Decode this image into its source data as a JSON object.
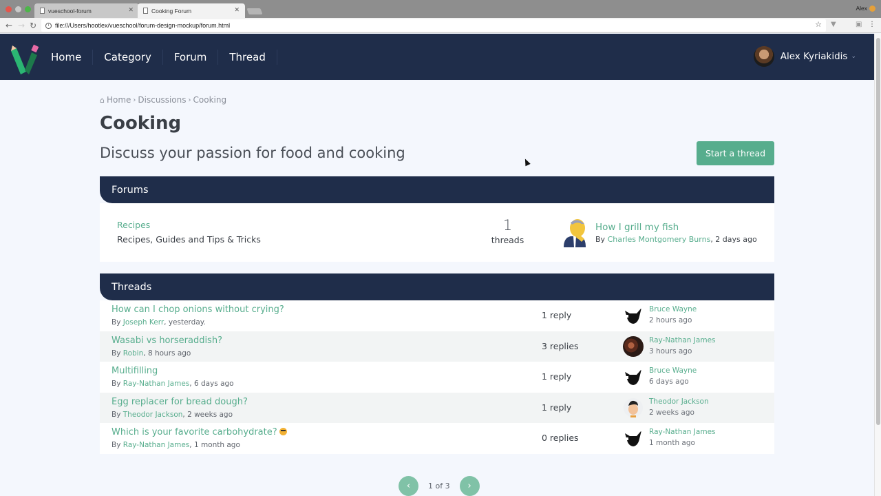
{
  "browser": {
    "tabs": [
      {
        "title": "vueschool-forum",
        "active": false
      },
      {
        "title": "Cooking Forum",
        "active": true
      }
    ],
    "profile_name": "Alex",
    "url": "file:///Users/hootlex/vueschool/forum-design-mockup/forum.html"
  },
  "navbar": {
    "links": [
      "Home",
      "Category",
      "Forum",
      "Thread"
    ],
    "user_name": "Alex Kyriakidis"
  },
  "breadcrumb": [
    "Home",
    "Discussions",
    "Cooking"
  ],
  "page": {
    "title": "Cooking",
    "description": "Discuss your passion for food and cooking",
    "start_thread_label": "Start a thread"
  },
  "forums_section": {
    "heading": "Forums",
    "forums": [
      {
        "name": "Recipes",
        "description": "Recipes, Guides and Tips & Tricks",
        "thread_count": "1",
        "thread_count_label": "threads",
        "last_post_title": "How I grill my fish",
        "last_post_by_label": "By",
        "last_post_author": "Charles Montgomery Burns",
        "last_post_time": ", 2 days ago"
      }
    ]
  },
  "threads_section": {
    "heading": "Threads",
    "threads": [
      {
        "title": "How can I chop onions without crying?",
        "author": "Joseph Kerr",
        "time": ", yesterday.",
        "replies": "1 reply",
        "last_user": "Bruce Wayne",
        "last_time": "2 hours ago",
        "avatar": "cat-avatar"
      },
      {
        "title": "Wasabi vs horseraddish?",
        "author": "Robin",
        "time": ", 8 hours ago",
        "replies": "3 replies",
        "last_user": "Ray-Nathan James",
        "last_time": "3 hours ago",
        "avatar": "photo-avatar"
      },
      {
        "title": "Multifilling",
        "author": "Ray-Nathan James",
        "time": ", 6 days ago",
        "replies": "1 reply",
        "last_user": "Bruce Wayne",
        "last_time": "6 days ago",
        "avatar": "cat-avatar"
      },
      {
        "title": "Egg replacer for bread dough?",
        "author": "Theodor Jackson",
        "time": ", 2 weeks ago",
        "replies": "1 reply",
        "last_user": "Theodor Jackson",
        "last_time": "2 weeks ago",
        "avatar": "cartoon-avatar"
      },
      {
        "title": "Which is your favorite carbohydrate?",
        "author": "Ray-Nathan James",
        "time": ", 1 month ago",
        "replies": "0 replies",
        "last_user": "Ray-Nathan James",
        "last_time": "1 month ago",
        "avatar": "cat-avatar"
      }
    ],
    "by_label": "By "
  },
  "pagination": {
    "text": "1 of 3",
    "prev_icon": "chevron-left-icon",
    "next_icon": "chevron-right-icon"
  },
  "colors": {
    "navbar": "#1f2d4a",
    "accent": "#57ad8d",
    "background": "#f4f7fd"
  }
}
